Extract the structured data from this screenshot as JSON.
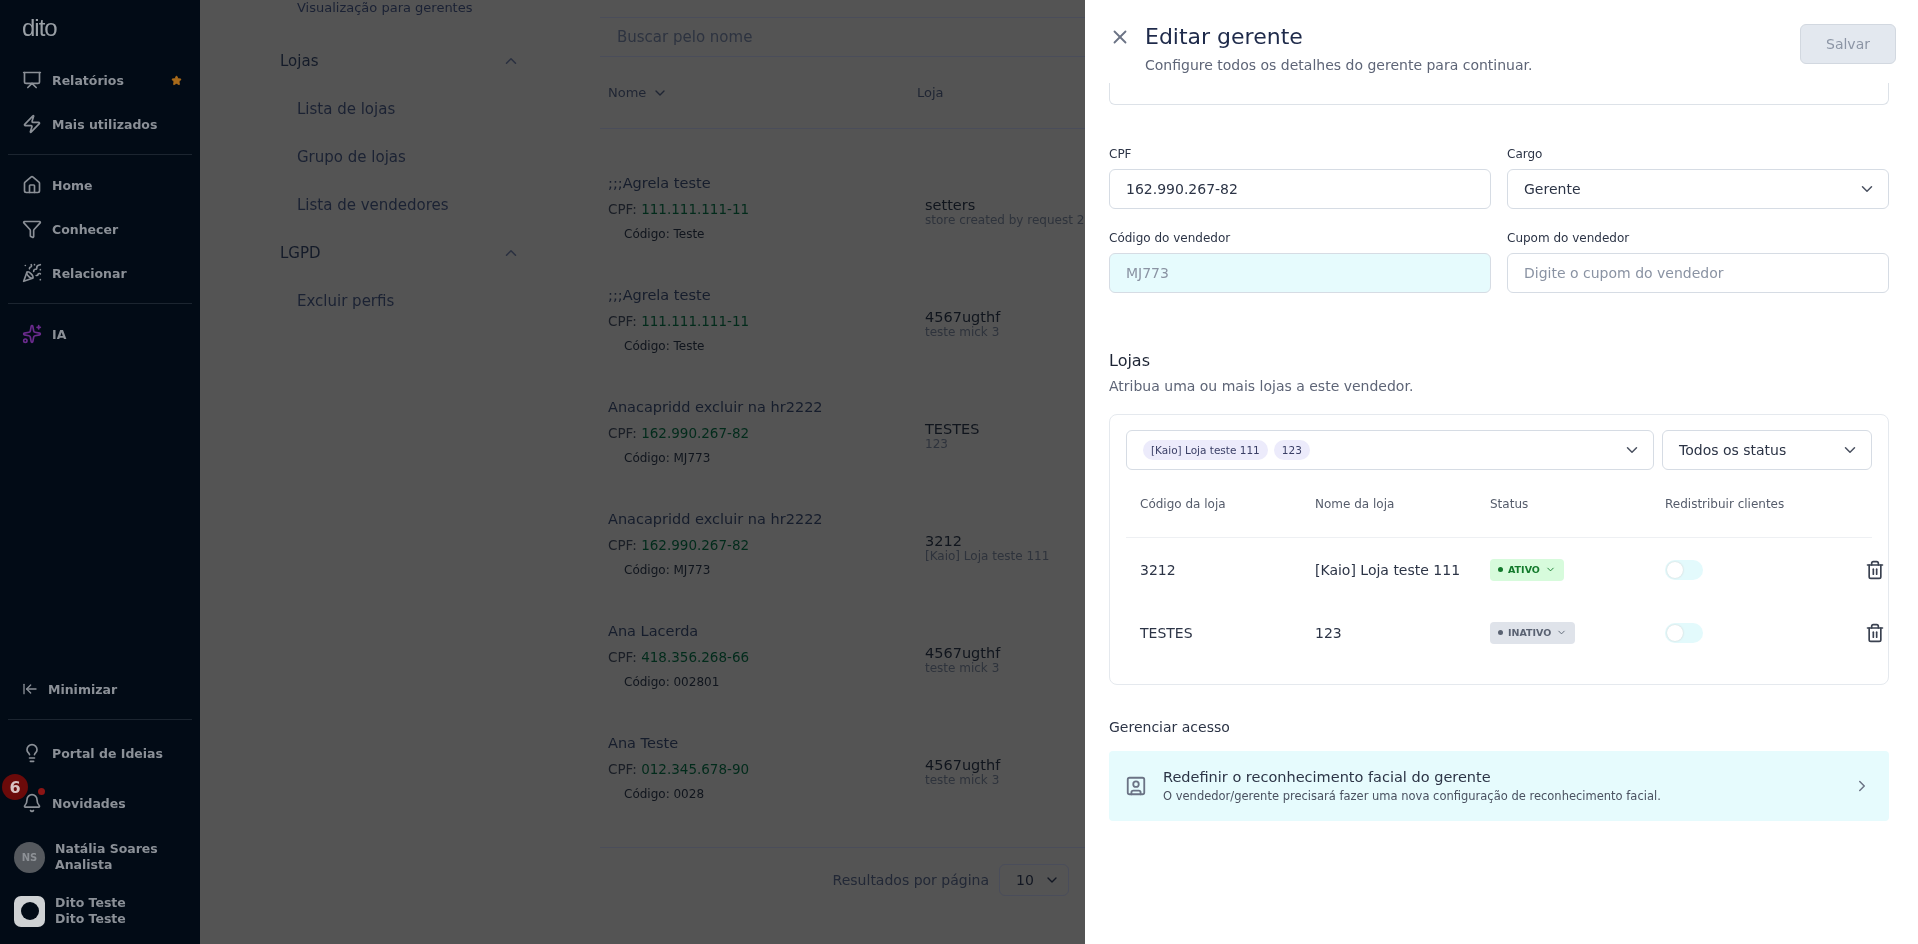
{
  "sidebar": {
    "logo": "dito",
    "items": [
      {
        "label": "Relatórios",
        "favorite": true
      },
      {
        "label": "Mais utilizados",
        "favorite": false
      },
      {
        "label": "Home",
        "favorite": false
      },
      {
        "label": "Conhecer",
        "favorite": false
      },
      {
        "label": "Relacionar",
        "favorite": false
      },
      {
        "label": "IA",
        "favorite": false
      }
    ],
    "minimize": "Minimizar",
    "bottom_items": [
      {
        "label": "Portal de Ideias"
      },
      {
        "label": "Novidades",
        "badge": "6"
      }
    ],
    "user": {
      "initials": "NS",
      "name": "Natália Soares",
      "role": "Analista"
    },
    "workspace": {
      "name": "Dito Teste",
      "subtitle": "Dito Teste"
    }
  },
  "settings_menu": {
    "cut_item": "Visualização para gerentes",
    "groups": [
      {
        "title": "Lojas",
        "expanded": true,
        "items": [
          "Lista de lojas",
          "Grupo de lojas",
          "Lista de vendedores"
        ]
      },
      {
        "title": "LGPD",
        "expanded": true,
        "items": [
          "Excluir perfis"
        ]
      }
    ]
  },
  "list": {
    "search": {
      "placeholder": "Buscar pelo nome"
    },
    "columns": [
      "Nome",
      "Loja"
    ],
    "rows": [
      {
        "name": ";;;Agrela teste",
        "cpf_label": "CPF:",
        "cpf": "111.111.111-11",
        "code": "Código: Teste",
        "store": "setters",
        "store_detail": "store created by request 2"
      },
      {
        "name": ";;;Agrela teste",
        "cpf_label": "CPF:",
        "cpf": "111.111.111-11",
        "code": "Código: Teste",
        "store": "4567ugthf",
        "store_detail": "teste mick 3"
      },
      {
        "name": "Anacapridd excluir na hr2222",
        "cpf_label": "CPF:",
        "cpf": "162.990.267-82",
        "code": "Código: MJ773",
        "store": "TESTES",
        "store_detail": "123"
      },
      {
        "name": "Anacapridd excluir na hr2222",
        "cpf_label": "CPF:",
        "cpf": "162.990.267-82",
        "code": "Código: MJ773",
        "store": "3212",
        "store_detail": "[Kaio] Loja teste 111"
      },
      {
        "name": "Ana Lacerda",
        "cpf_label": "CPF:",
        "cpf": "418.356.268-66",
        "code": "Código: 002801",
        "store": "4567ugthf",
        "store_detail": "teste mick 3"
      },
      {
        "name": "Ana Teste",
        "cpf_label": "CPF:",
        "cpf": "012.345.678-90",
        "code": "Código: 0028",
        "store": "4567ugthf",
        "store_detail": "teste mick 3"
      }
    ],
    "pagination": {
      "label": "Resultados por página",
      "value": "10"
    }
  },
  "drawer": {
    "title": "Editar gerente",
    "subtitle": "Configure todos os detalhes do gerente para continuar.",
    "save": {
      "label": "Salvar",
      "disabled": true
    },
    "fields": [
      {
        "kind": "input",
        "label": "CPF",
        "value": "162.990.267-82",
        "readonly": false
      },
      {
        "kind": "select",
        "label": "Cargo",
        "value": "Gerente",
        "readonly": false
      },
      {
        "kind": "input",
        "label": "Código do vendedor",
        "value": "MJ773",
        "readonly": true
      },
      {
        "kind": "input",
        "label": "Cupom do vendedor",
        "placeholder": "Digite o cupom do vendedor",
        "readonly": false
      }
    ],
    "stores": {
      "heading": "Lojas",
      "description": "Atribua uma ou mais lojas a este vendedor.",
      "tags": [
        "[Kaio] Loja teste 111",
        "123"
      ],
      "status_filter": "Todos os status",
      "columns": [
        "Código da loja",
        "Nome da loja",
        "Status",
        "Redistribuir clientes"
      ],
      "rows": [
        {
          "code": "3212",
          "name": "[Kaio] Loja teste 111",
          "status": "ATIVO",
          "active": true,
          "redistribute": false
        },
        {
          "code": "TESTES",
          "name": "123",
          "status": "INATIVO",
          "active": false,
          "redistribute": false
        }
      ]
    },
    "access": {
      "heading": "Gerenciar acesso",
      "title": "Redefinir o reconhecimento facial do gerente",
      "description": "O vendedor/gerente precisará fazer uma nova configuração de reconhecimento facial."
    }
  }
}
